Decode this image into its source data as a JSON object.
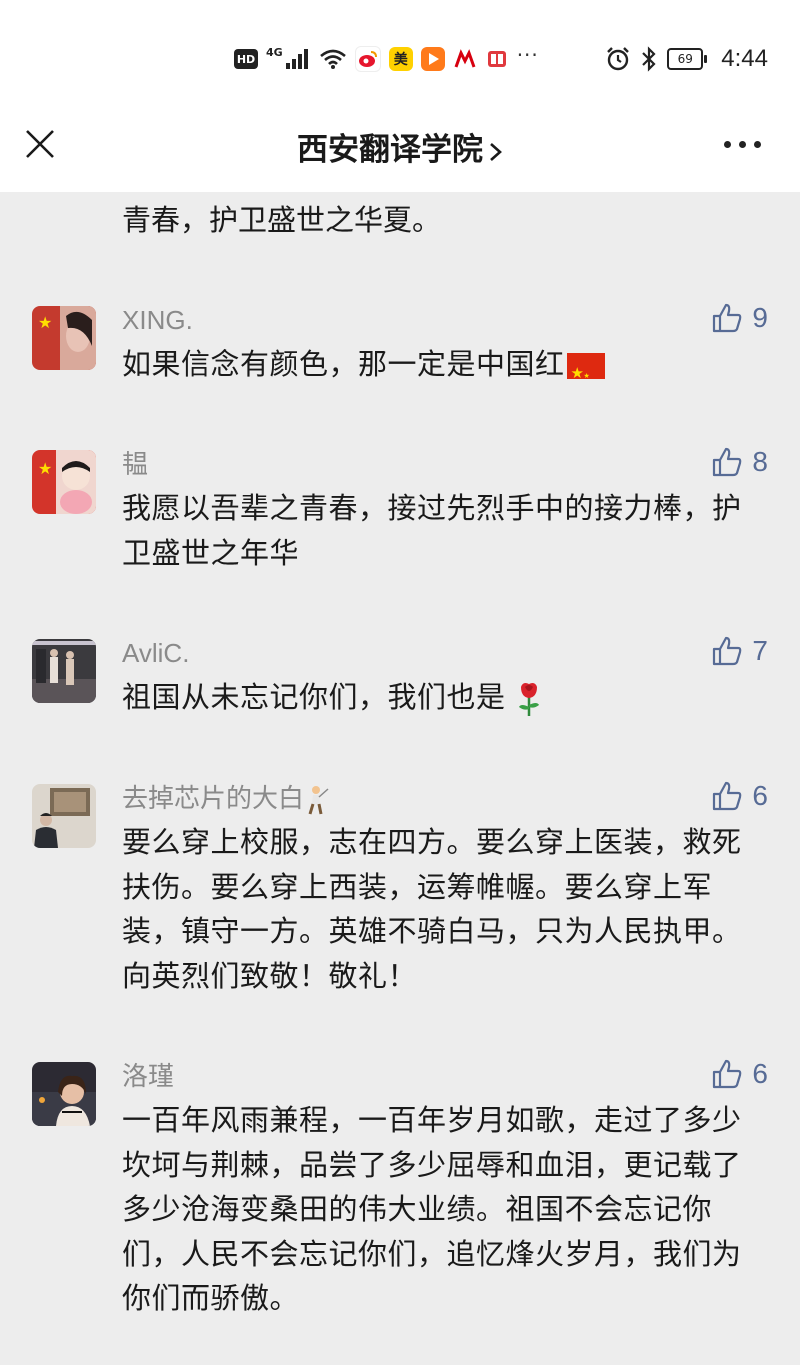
{
  "status_bar": {
    "hd": "HD",
    "network": "4G",
    "apps": [
      "weibo-icon",
      "meituan-icon",
      "video-play-icon",
      "cmb-bank-icon",
      "reader-book-icon"
    ],
    "app_labels": {
      "mei": "美",
      "cmb": "招"
    },
    "more": "···",
    "battery": "69",
    "time": "4:44"
  },
  "nav": {
    "title": "西安翻译学院",
    "close_icon": "close-icon",
    "more_icon": "more-icon"
  },
  "previous_comment_tail": "青春，护卫盛世之华夏。",
  "comments": [
    {
      "user": "XING.",
      "likes": "9",
      "text": "如果信念有颜色，那一定是中国红",
      "emoji": "china-flag"
    },
    {
      "user": "韫",
      "likes": "8",
      "text": "我愿以吾辈之青春，接过先烈手中的接力棒，护卫盛世之年华"
    },
    {
      "user": "AvliC.",
      "likes": "7",
      "text": "祖国从未忘记你们，我们也是",
      "emoji": "rose"
    },
    {
      "user": "去掉芯片的大白",
      "user_emoji": "golfer",
      "likes": "6",
      "text": "要么穿上校服，志在四方。要么穿上医装，救死扶伤。要么穿上西装，运筹帷幄。要么穿上军装，镇守一方。英雄不骑白马，只为人民执甲。向英烈们致敬！敬礼！"
    },
    {
      "user": "洛瑾",
      "likes": "6",
      "text": "一百年风雨兼程，一百年岁月如歌，走过了多少坎坷与荆棘，品尝了多少屈辱和血泪，更记载了多少沧海变桑田的伟大业绩。祖国不会忘记你们，人民不会忘记你们，追忆烽火岁月，我们为你们而骄傲。"
    }
  ],
  "colors": {
    "background": "#ededed",
    "bar": "#ffffff",
    "like_blue": "#576b95",
    "name_gray": "#8a8a8a"
  }
}
